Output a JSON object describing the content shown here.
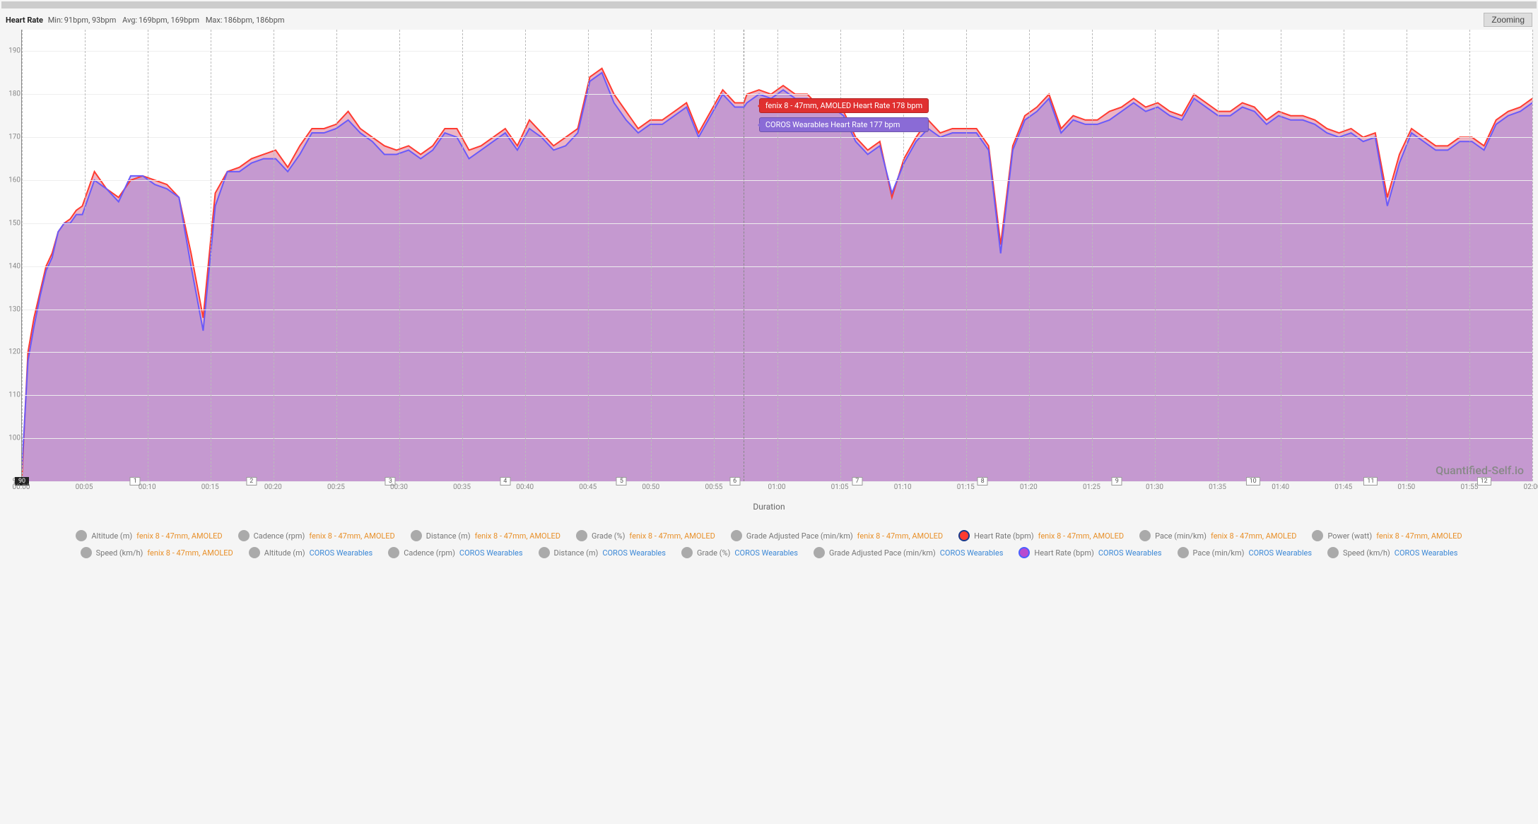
{
  "stats": {
    "title": "Heart Rate",
    "min_label": "Min:",
    "min_values": "91bpm, 93bpm",
    "avg_label": "Avg:",
    "avg_values": "169bpm, 169bpm",
    "max_label": "Max:",
    "max_values": "186bpm, 186bpm",
    "zoom_button": "Zooming"
  },
  "chart_data": {
    "type": "area",
    "title": "Heart Rate",
    "xlabel": "Duration",
    "ylabel": "",
    "ylim": [
      90,
      195
    ],
    "y_ticks": [
      90,
      100,
      110,
      120,
      130,
      140,
      150,
      160,
      170,
      180,
      190
    ],
    "x_ticks": [
      "00:00",
      "00:05",
      "00:10",
      "00:15",
      "00:20",
      "00:25",
      "00:30",
      "00:35",
      "00:40",
      "00:45",
      "00:50",
      "00:55",
      "01:00",
      "01:05",
      "01:10",
      "01:15",
      "01:20",
      "01:25",
      "01:30",
      "01:35",
      "01:40",
      "01:45",
      "01:50",
      "01:55",
      "02:00"
    ],
    "km_markers": [
      {
        "label": "90",
        "xfrac": 0.0,
        "dark": true
      },
      {
        "label": "1",
        "xfrac": 0.075
      },
      {
        "label": "2",
        "xfrac": 0.152
      },
      {
        "label": "3",
        "xfrac": 0.244
      },
      {
        "label": "4",
        "xfrac": 0.32
      },
      {
        "label": "5",
        "xfrac": 0.397
      },
      {
        "label": "6",
        "xfrac": 0.472
      },
      {
        "label": "7",
        "xfrac": 0.553
      },
      {
        "label": "8",
        "xfrac": 0.636
      },
      {
        "label": "9",
        "xfrac": 0.725
      },
      {
        "label": "10",
        "xfrac": 0.815
      },
      {
        "label": "11",
        "xfrac": 0.893
      },
      {
        "label": "12",
        "xfrac": 0.968
      }
    ],
    "series": [
      {
        "name": "fenix 8 - 47mm, AMOLED Heart Rate",
        "color": "#ff3b30",
        "fill": "rgba(221,120,150,0.55)",
        "tooltip_x": 0.478,
        "tooltip_value": "fenix 8 - 47mm, AMOLED Heart Rate 178 bpm",
        "values_at_5min": [
          91,
          154,
          159,
          145,
          166,
          172,
          166,
          172,
          169,
          183,
          175,
          179,
          177,
          178,
          174,
          168,
          175,
          163,
          175,
          176,
          176,
          174,
          171,
          168,
          178
        ]
      },
      {
        "name": "COROS Wearables Heart Rate",
        "color": "#6a5af9",
        "fill": "rgba(150,120,221,0.45)",
        "tooltip_x": 0.478,
        "tooltip_value": "COROS Wearables Heart Rate 177 bpm",
        "values_at_5min": [
          93,
          152,
          160,
          143,
          165,
          171,
          165,
          171,
          168,
          182,
          174,
          178,
          177,
          177,
          172,
          167,
          173,
          161,
          174,
          175,
          175,
          173,
          170,
          167,
          177
        ]
      }
    ],
    "series_dense": {
      "x": [
        0,
        0.004,
        0.008,
        0.012,
        0.016,
        0.02,
        0.024,
        0.028,
        0.032,
        0.036,
        0.04,
        0.048,
        0.056,
        0.064,
        0.072,
        0.08,
        0.088,
        0.096,
        0.104,
        0.112,
        0.12,
        0.128,
        0.136,
        0.144,
        0.152,
        0.16,
        0.168,
        0.176,
        0.184,
        0.192,
        0.2,
        0.208,
        0.216,
        0.224,
        0.232,
        0.24,
        0.248,
        0.256,
        0.264,
        0.272,
        0.28,
        0.288,
        0.296,
        0.304,
        0.312,
        0.32,
        0.328,
        0.336,
        0.344,
        0.352,
        0.36,
        0.368,
        0.376,
        0.384,
        0.392,
        0.4,
        0.408,
        0.416,
        0.424,
        0.432,
        0.44,
        0.448,
        0.456,
        0.464,
        0.472,
        0.478,
        0.48,
        0.488,
        0.496,
        0.504,
        0.512,
        0.52,
        0.528,
        0.536,
        0.544,
        0.552,
        0.56,
        0.568,
        0.576,
        0.584,
        0.592,
        0.6,
        0.608,
        0.616,
        0.624,
        0.632,
        0.64,
        0.648,
        0.656,
        0.664,
        0.672,
        0.68,
        0.688,
        0.696,
        0.704,
        0.712,
        0.72,
        0.728,
        0.736,
        0.744,
        0.752,
        0.76,
        0.768,
        0.776,
        0.784,
        0.792,
        0.8,
        0.808,
        0.816,
        0.824,
        0.832,
        0.84,
        0.848,
        0.856,
        0.864,
        0.872,
        0.88,
        0.888,
        0.896,
        0.904,
        0.912,
        0.92,
        0.928,
        0.936,
        0.944,
        0.952,
        0.96,
        0.968,
        0.976,
        0.984,
        0.992,
        1.0
      ],
      "fenix": [
        91,
        120,
        128,
        134,
        140,
        143,
        148,
        150,
        151,
        153,
        154,
        162,
        158,
        156,
        160,
        161,
        160,
        159,
        156,
        143,
        128,
        157,
        162,
        163,
        165,
        166,
        167,
        163,
        168,
        172,
        172,
        173,
        176,
        172,
        170,
        168,
        167,
        168,
        166,
        168,
        172,
        172,
        167,
        168,
        170,
        172,
        168,
        174,
        171,
        168,
        170,
        172,
        184,
        186,
        180,
        176,
        172,
        174,
        174,
        176,
        178,
        171,
        176,
        181,
        178,
        178,
        180,
        181,
        180,
        182,
        180,
        180,
        177,
        178,
        176,
        170,
        167,
        169,
        156,
        165,
        170,
        174,
        171,
        172,
        172,
        172,
        168,
        145,
        168,
        175,
        177,
        180,
        172,
        175,
        174,
        174,
        176,
        177,
        179,
        177,
        178,
        176,
        175,
        180,
        178,
        176,
        176,
        178,
        177,
        174,
        176,
        175,
        175,
        174,
        172,
        171,
        172,
        170,
        171,
        156,
        166,
        172,
        170,
        168,
        168,
        170,
        170,
        168,
        174,
        176,
        177,
        179
      ],
      "coros": [
        93,
        118,
        126,
        133,
        139,
        142,
        148,
        150,
        150,
        152,
        152,
        160,
        158,
        155,
        161,
        161,
        159,
        158,
        156,
        140,
        125,
        154,
        162,
        162,
        164,
        165,
        165,
        162,
        166,
        171,
        171,
        172,
        174,
        171,
        169,
        166,
        166,
        167,
        165,
        167,
        171,
        170,
        165,
        167,
        169,
        171,
        167,
        172,
        170,
        167,
        168,
        171,
        183,
        185,
        178,
        174,
        171,
        173,
        173,
        175,
        177,
        170,
        175,
        180,
        177,
        177,
        178,
        180,
        179,
        181,
        179,
        179,
        176,
        177,
        175,
        169,
        166,
        168,
        157,
        164,
        169,
        172,
        170,
        171,
        171,
        171,
        167,
        143,
        167,
        174,
        176,
        179,
        171,
        174,
        173,
        173,
        174,
        176,
        178,
        176,
        177,
        175,
        174,
        179,
        177,
        175,
        175,
        177,
        176,
        173,
        175,
        174,
        174,
        173,
        171,
        170,
        171,
        169,
        170,
        154,
        164,
        171,
        169,
        167,
        167,
        169,
        169,
        167,
        173,
        175,
        176,
        178
      ]
    }
  },
  "tooltips": {
    "cursor_x": 0.478,
    "red_text": "fenix 8 - 47mm, AMOLED Heart Rate 178 bpm",
    "purple_text": "COROS Wearables Heart Rate 177 bpm"
  },
  "watermark": "Quantified-Self.io",
  "legend": [
    {
      "metric": "Altitude (m)",
      "device": "fenix 8 - 47mm, AMOLED",
      "device_class": "orange",
      "active": false
    },
    {
      "metric": "Cadence (rpm)",
      "device": "fenix 8 - 47mm, AMOLED",
      "device_class": "orange",
      "active": false
    },
    {
      "metric": "Distance (m)",
      "device": "fenix 8 - 47mm, AMOLED",
      "device_class": "orange",
      "active": false
    },
    {
      "metric": "Grade (%)",
      "device": "fenix 8 - 47mm, AMOLED",
      "device_class": "orange",
      "active": false
    },
    {
      "metric": "Grade Adjusted Pace (min/km)",
      "device": "fenix 8 - 47mm, AMOLED",
      "device_class": "orange",
      "active": false
    },
    {
      "metric": "Heart Rate (bpm)",
      "device": "fenix 8 - 47mm, AMOLED",
      "device_class": "orange",
      "active": "red"
    },
    {
      "metric": "Pace (min/km)",
      "device": "fenix 8 - 47mm, AMOLED",
      "device_class": "orange",
      "active": false
    },
    {
      "metric": "Power (watt)",
      "device": "fenix 8 - 47mm, AMOLED",
      "device_class": "orange",
      "active": false
    },
    {
      "metric": "Speed (km/h)",
      "device": "fenix 8 - 47mm, AMOLED",
      "device_class": "orange",
      "active": false
    },
    {
      "metric": "Altitude (m)",
      "device": "COROS Wearables",
      "device_class": "blue",
      "active": false
    },
    {
      "metric": "Cadence (rpm)",
      "device": "COROS Wearables",
      "device_class": "blue",
      "active": false
    },
    {
      "metric": "Distance (m)",
      "device": "COROS Wearables",
      "device_class": "blue",
      "active": false
    },
    {
      "metric": "Grade (%)",
      "device": "COROS Wearables",
      "device_class": "blue",
      "active": false
    },
    {
      "metric": "Grade Adjusted Pace (min/km)",
      "device": "COROS Wearables",
      "device_class": "blue",
      "active": false
    },
    {
      "metric": "Heart Rate (bpm)",
      "device": "COROS Wearables",
      "device_class": "blue",
      "active": "purple"
    },
    {
      "metric": "Pace (min/km)",
      "device": "COROS Wearables",
      "device_class": "blue",
      "active": false
    },
    {
      "metric": "Speed (km/h)",
      "device": "COROS Wearables",
      "device_class": "blue",
      "active": false
    }
  ]
}
